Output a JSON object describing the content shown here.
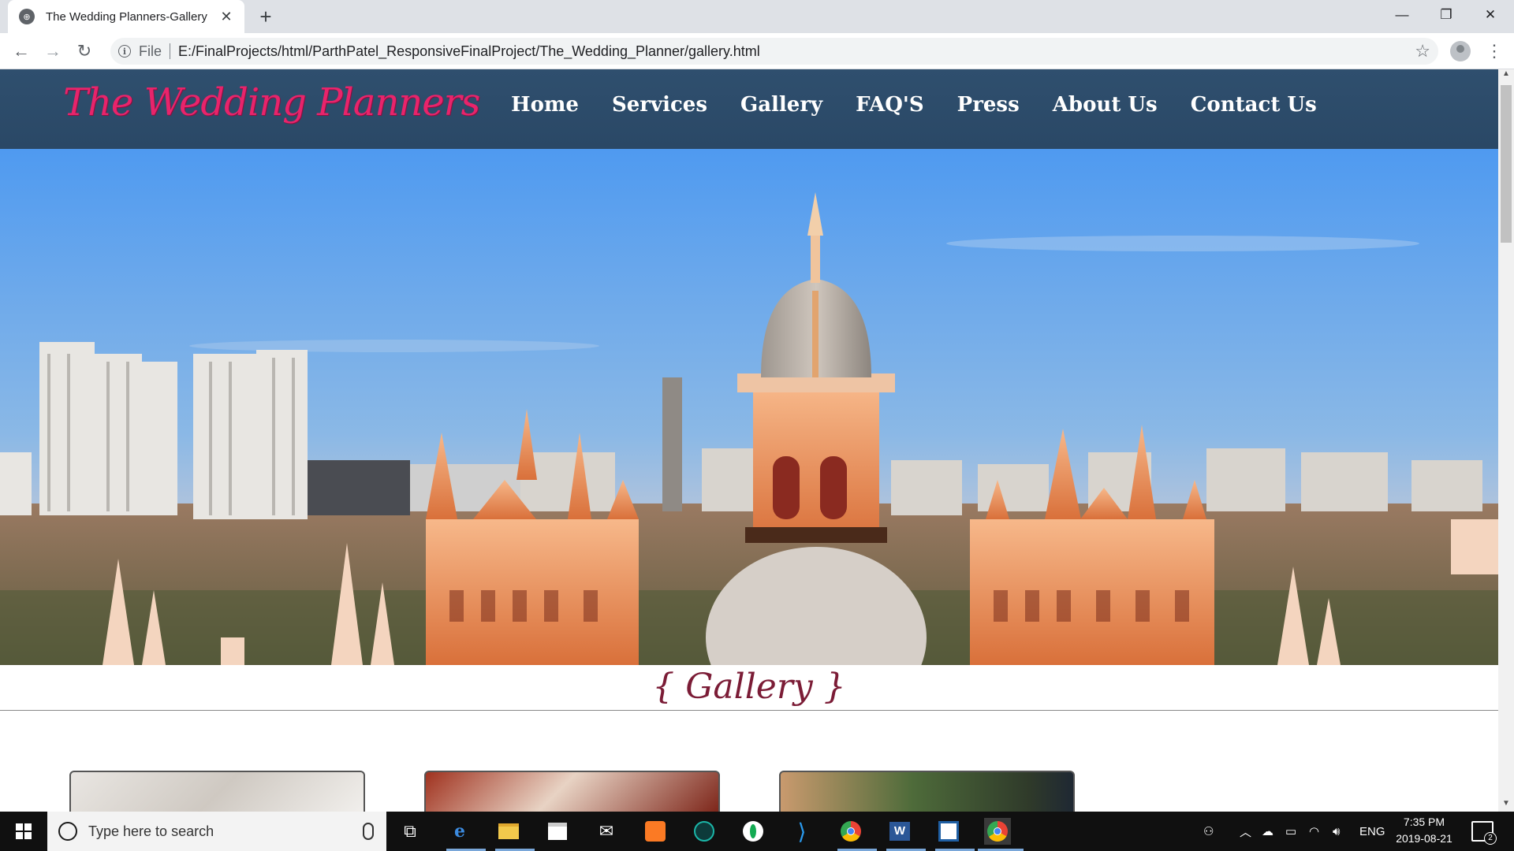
{
  "browser": {
    "tab_title": "The Wedding Planners-Gallery",
    "tab_close": "✕",
    "new_tab": "+",
    "scheme_label": "File",
    "url": "E:/FinalProjects/html/ParthPatel_ResponsiveFinalProject/The_Wedding_Planner/gallery.html",
    "info_glyph": "i",
    "window_controls": {
      "minimize": "—",
      "restore": "❐",
      "close": "✕"
    },
    "nav": {
      "back": "←",
      "forward": "→",
      "reload": "↻"
    },
    "bookmark_star": "☆",
    "menu": "⋮"
  },
  "site": {
    "logo_text": "The Wedding Planners",
    "nav_items": [
      "Home",
      "Services",
      "Gallery",
      "FAQ'S",
      "Press",
      "About Us",
      "Contact Us"
    ],
    "section_title": "{ Gallery }"
  },
  "taskbar": {
    "search_placeholder": "Type here to search",
    "language": "ENG",
    "time": "7:35 PM",
    "date": "2019-08-21",
    "notification_count": "2",
    "pinned_icons": [
      "task-view-icon",
      "edge-icon",
      "file-explorer-icon",
      "store-icon",
      "mail-icon",
      "xampp-icon",
      "gitkraken-icon",
      "mongodb-icon",
      "vscode-icon",
      "chrome-icon",
      "word-icon",
      "brackets-icon",
      "chrome-active-icon"
    ]
  },
  "colors": {
    "header_bg": "#2d4c6b",
    "logo": "#e8246b",
    "section_title": "#7b1c36",
    "taskbar_bg": "#101010"
  }
}
